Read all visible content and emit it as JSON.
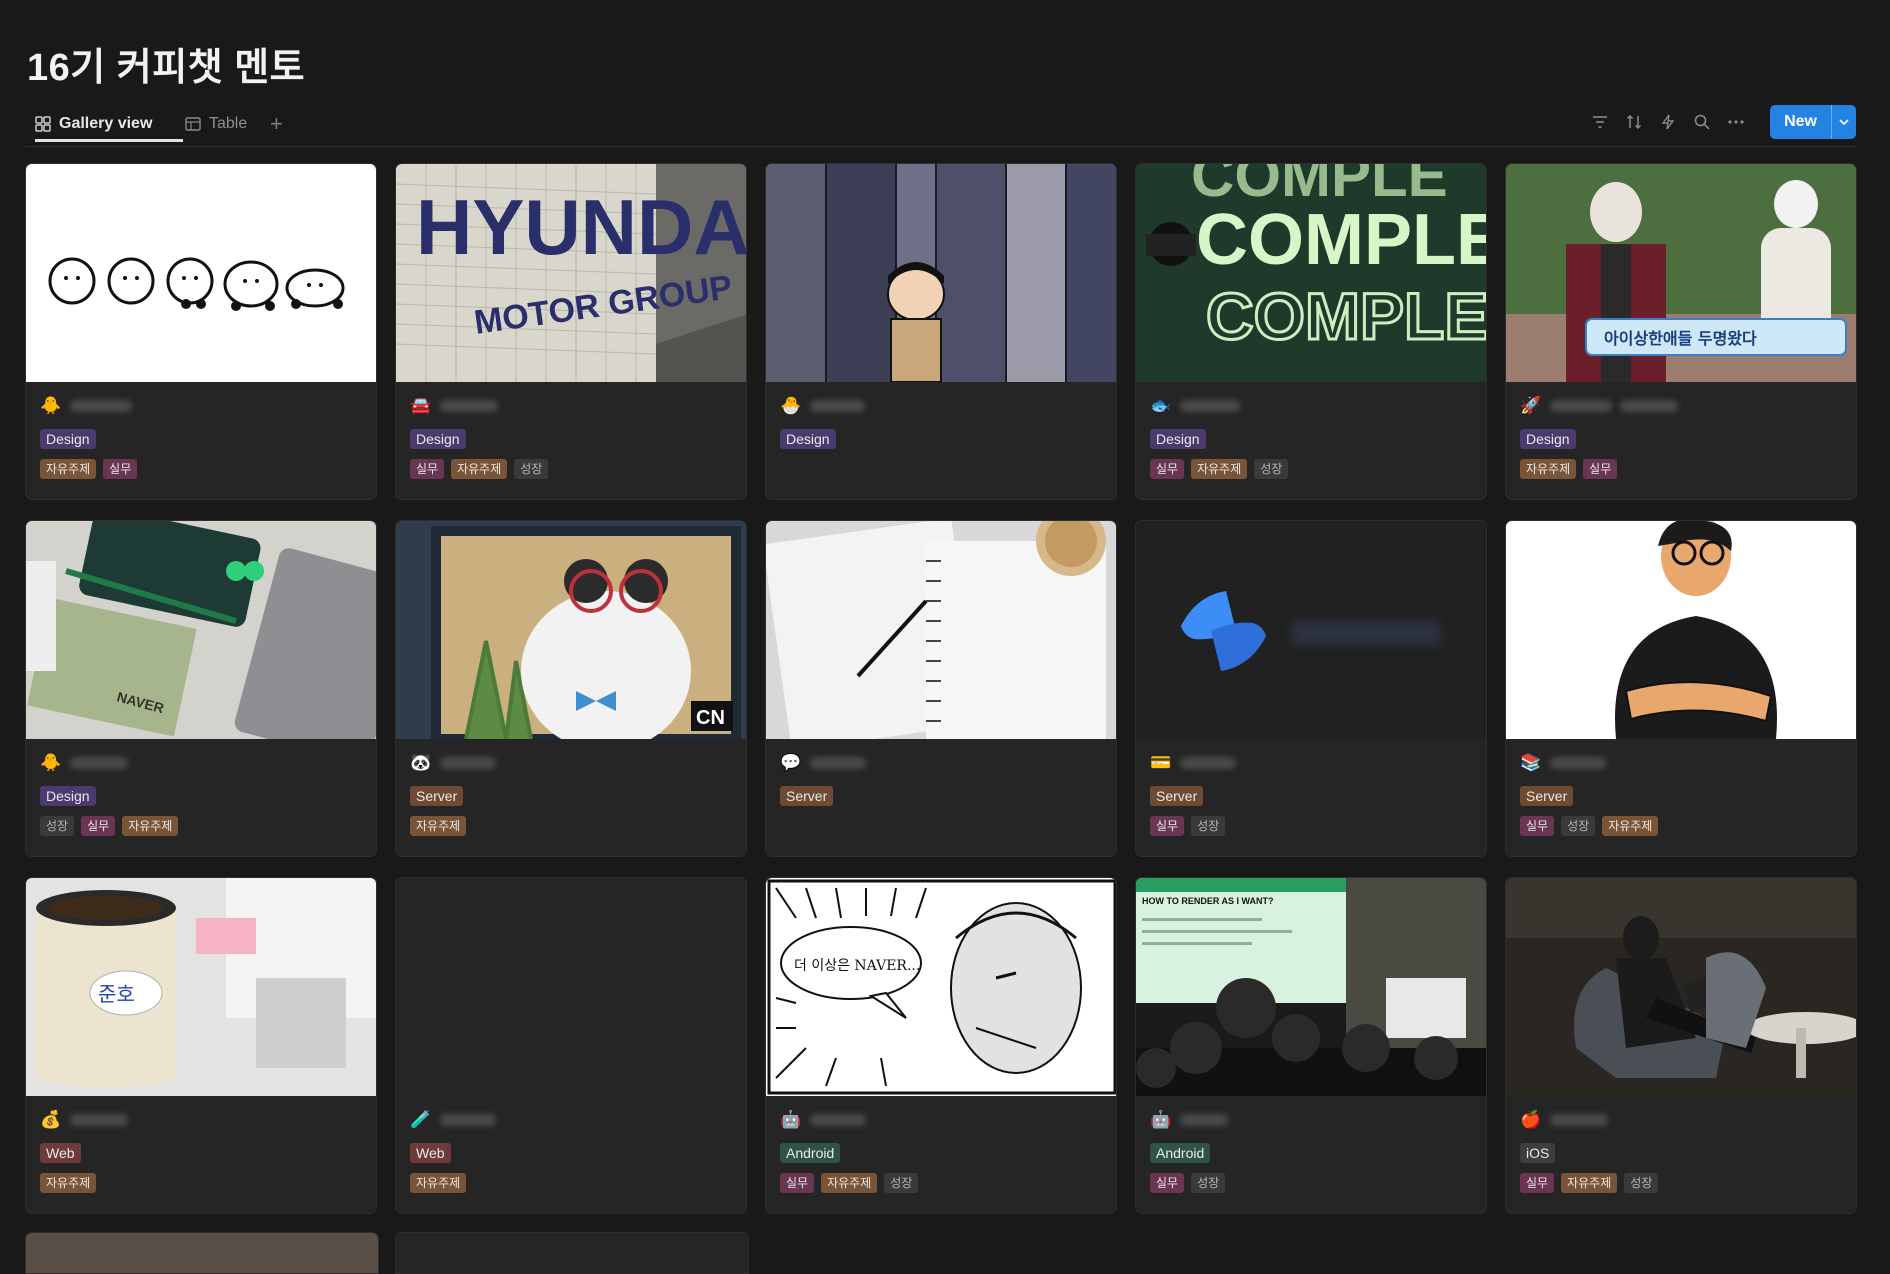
{
  "page": {
    "title": "16기 커피챗 멘토"
  },
  "views": {
    "tabs": [
      {
        "label": "Gallery view",
        "icon": "gallery-grid-icon",
        "active": true
      },
      {
        "label": "Table",
        "icon": "table-icon",
        "active": false
      }
    ],
    "add_icon": "plus-icon"
  },
  "toolbar": {
    "icons": [
      "filter-icon",
      "sort-icon",
      "automation-icon",
      "search-icon",
      "more-icon"
    ],
    "new_label": "New",
    "new_caret_icon": "chevron-down-icon"
  },
  "colors": {
    "accent": "#2383e2",
    "background": "#191919",
    "card": "#252525"
  },
  "cards": [
    {
      "emoji": "🐥",
      "cover": "white-dog-drawings",
      "category": "Design",
      "tags": [
        "자유주제",
        "실무"
      ]
    },
    {
      "emoji": "🚘",
      "cover": "hyundai-motor-group-tiles",
      "category": "Design",
      "tags": [
        "실무",
        "자유주제",
        "성장"
      ]
    },
    {
      "emoji": "🐣",
      "cover": "cartoon-boy-with-suits",
      "category": "Design",
      "tags": []
    },
    {
      "emoji": "🐟",
      "cover": "green-complex-typography",
      "category": "Design",
      "tags": [
        "실무",
        "자유주제",
        "성장"
      ]
    },
    {
      "emoji": "🚀",
      "cover": "man-in-face-paint",
      "category": "Design",
      "tags": [
        "자유주제",
        "실무"
      ]
    },
    {
      "emoji": "🐥",
      "cover": "naver-business-cards",
      "category": "Design",
      "tags": [
        "성장",
        "실무",
        "자유주제"
      ]
    },
    {
      "emoji": "🐼",
      "cover": "cartoon-panda-glasses",
      "category": "Server",
      "tags": [
        "자유주제"
      ]
    },
    {
      "emoji": "💬",
      "cover": "notebook-and-pen",
      "category": "Server",
      "tags": []
    },
    {
      "emoji": "💳",
      "cover": "blue-logo-dark",
      "category": "Server",
      "tags": [
        "실무",
        "성장"
      ]
    },
    {
      "emoji": "📚",
      "cover": "illustrated-man-glasses",
      "category": "Server",
      "tags": [
        "실무",
        "성장",
        "자유주제"
      ]
    },
    {
      "emoji": "💰",
      "cover": "tumbler-on-desk",
      "category": "Web",
      "tags": [
        "자유주제"
      ]
    },
    {
      "emoji": "🧪",
      "cover": "empty",
      "category": "Web",
      "tags": [
        "자유주제"
      ]
    },
    {
      "emoji": "🤖",
      "cover": "comic-naver-speech",
      "category": "Android",
      "tags": [
        "실무",
        "자유주제",
        "성장"
      ]
    },
    {
      "emoji": "🤖",
      "cover": "conference-talk",
      "category": "Android",
      "tags": [
        "실무",
        "성장"
      ]
    },
    {
      "emoji": "🍎",
      "cover": "man-on-laptop-lounge",
      "category": "iOS",
      "tags": [
        "실무",
        "자유주제",
        "성장"
      ]
    }
  ],
  "comic": {
    "speech": "더 이상은 NAVER..."
  },
  "talk": {
    "slide_title": "HOW TO RENDER AS I WANT?"
  },
  "logo_text": {
    "hyundai": "HYUNDAI",
    "motor": "MOTOR GROUP",
    "complex": "COMPLE",
    "cn": "CN",
    "naver": "NAVER",
    "caption": "아이상한애들 두명왔다",
    "tumbler": "준호"
  }
}
